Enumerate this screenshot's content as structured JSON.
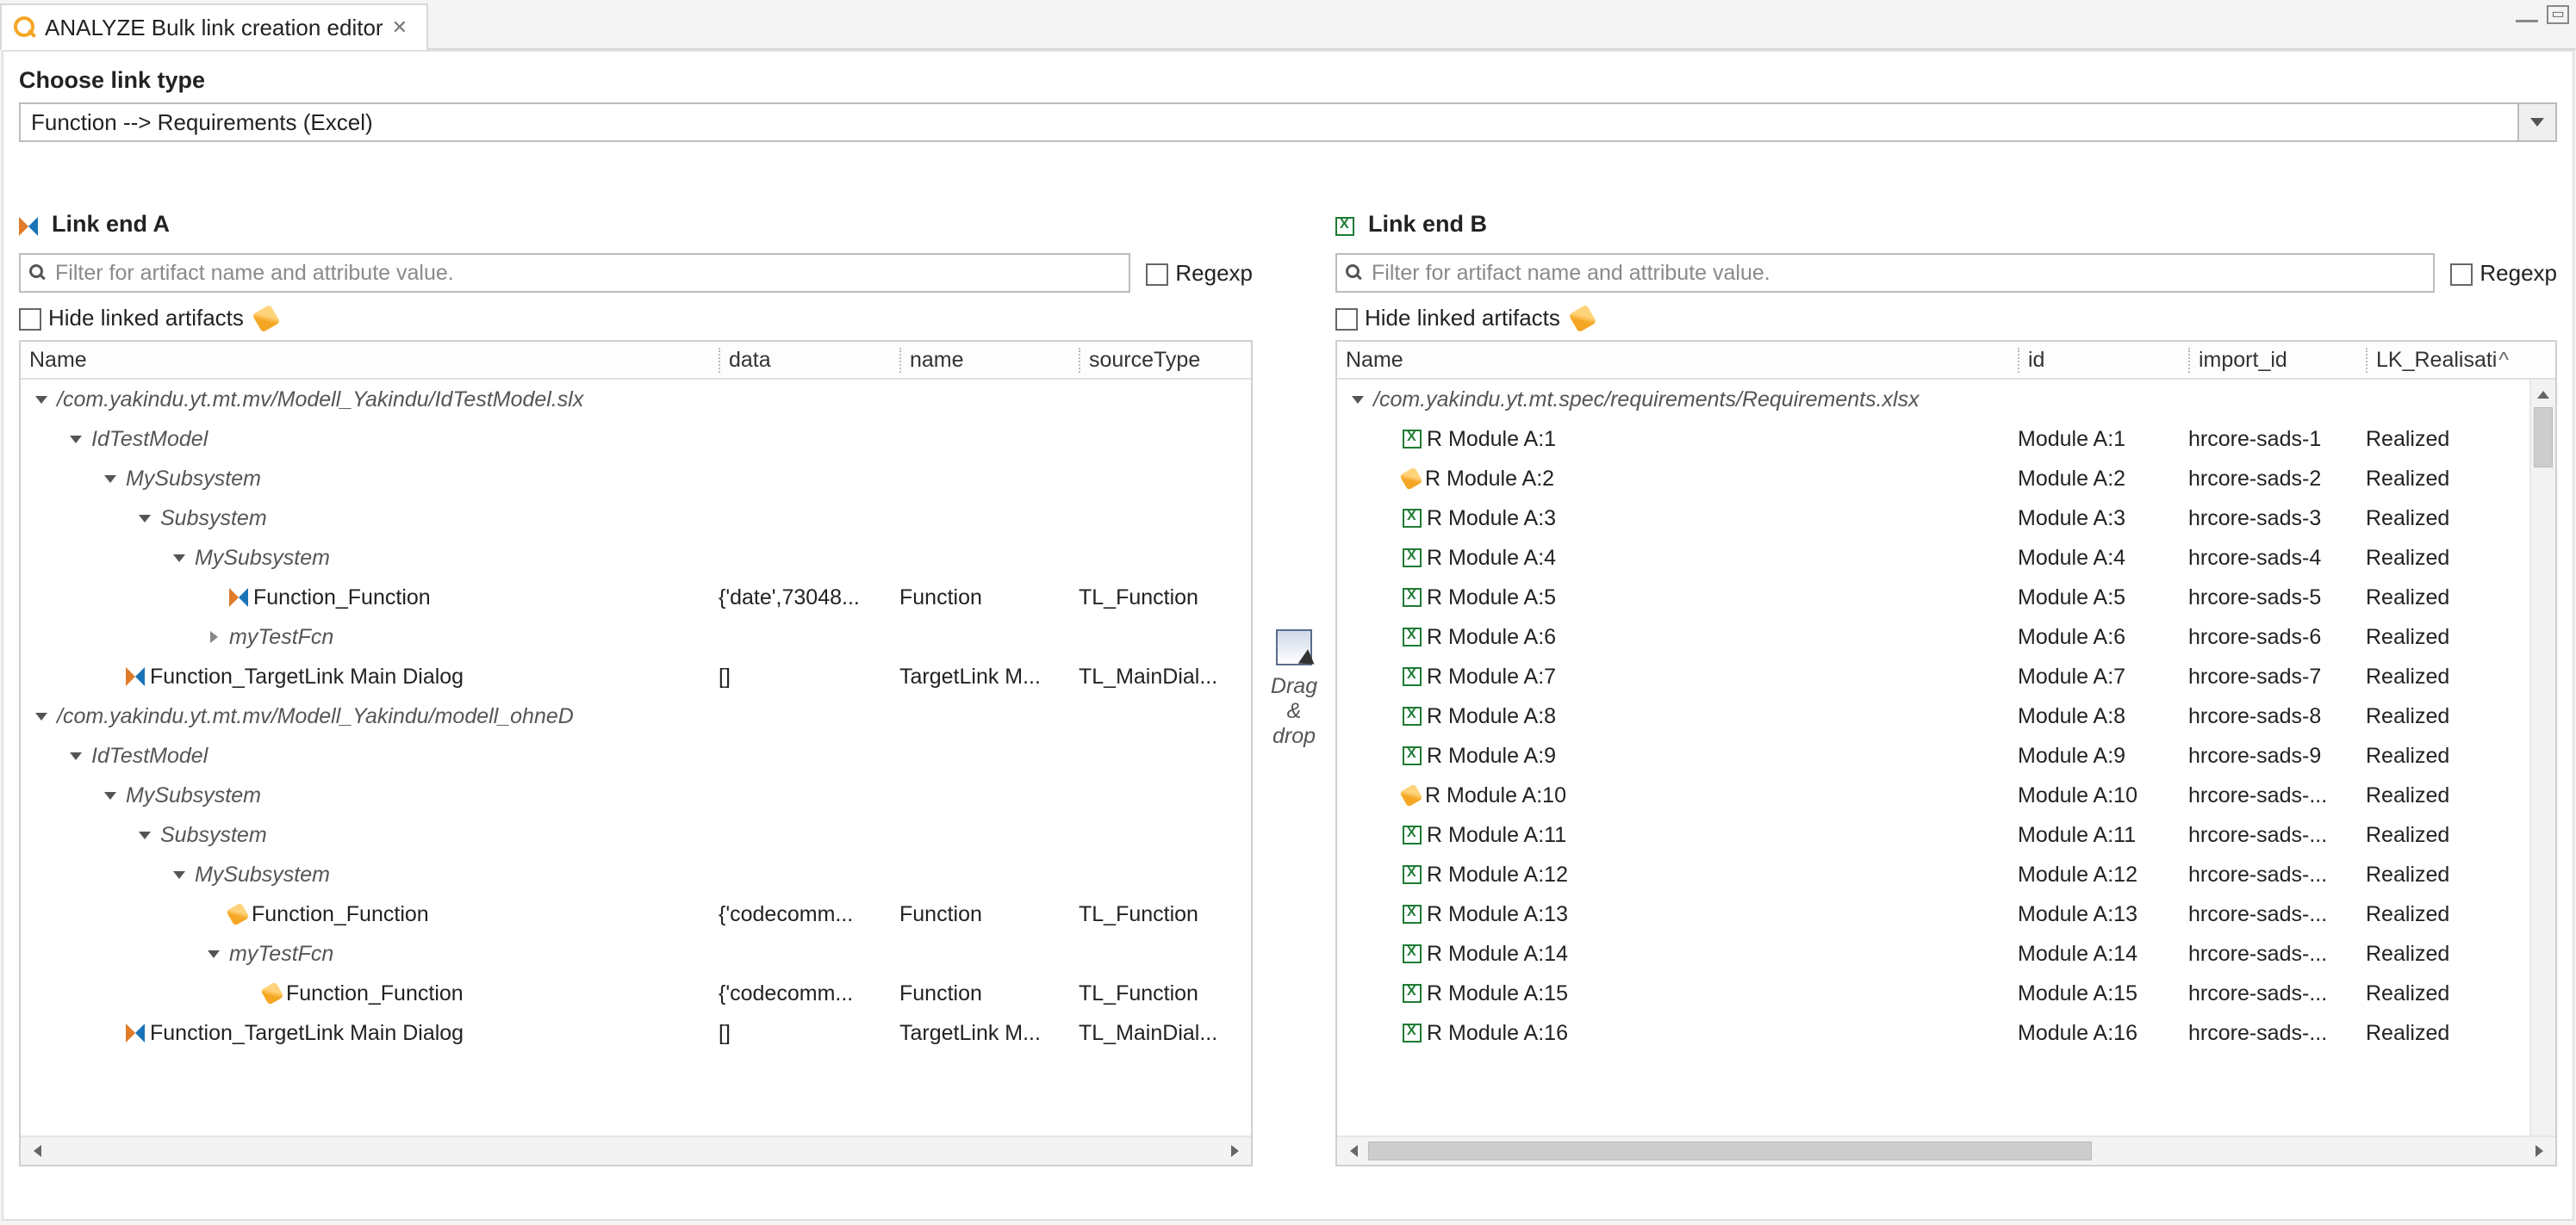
{
  "tab": {
    "title": "ANALYZE Bulk link creation editor"
  },
  "header": {
    "choose_label": "Choose link type",
    "link_type_value": "Function --> Requirements (Excel)"
  },
  "filters": {
    "placeholder": "Filter for artifact name and attribute value.",
    "regexp_label": "Regexp",
    "hide_linked_label": "Hide linked artifacts"
  },
  "divider": {
    "l1": "Drag",
    "l2": "&",
    "l3": "drop"
  },
  "paneA": {
    "title": "Link end A",
    "columns": {
      "name": "Name",
      "data": "data",
      "name2": "name",
      "src": "sourceType"
    },
    "rows": [
      {
        "d": 0,
        "tw": "down",
        "it": true,
        "t": "/com.yakindu.yt.mt.mv/Modell_Yakindu/IdTestModel.slx",
        "data": "",
        "n2": "",
        "src": ""
      },
      {
        "d": 1,
        "tw": "down",
        "it": true,
        "t": "IdTestModel",
        "data": "",
        "n2": "",
        "src": ""
      },
      {
        "d": 2,
        "tw": "down",
        "it": true,
        "t": "MySubsystem",
        "data": "",
        "n2": "",
        "src": ""
      },
      {
        "d": 3,
        "tw": "down",
        "it": true,
        "t": "Subsystem",
        "data": "",
        "n2": "",
        "src": ""
      },
      {
        "d": 4,
        "tw": "down",
        "it": true,
        "t": "MySubsystem",
        "data": "",
        "n2": "",
        "src": ""
      },
      {
        "d": 5,
        "tw": "",
        "icon": "ml",
        "t": "Function_Function",
        "data": "{'date',73048...",
        "n2": "Function",
        "src": "TL_Function"
      },
      {
        "d": 5,
        "tw": "right",
        "it": true,
        "t": "myTestFcn",
        "data": "",
        "n2": "",
        "src": ""
      },
      {
        "d": 2,
        "tw": "",
        "icon": "ml",
        "t": "Function_TargetLink Main Dialog",
        "data": "[]",
        "n2": "TargetLink M...",
        "src": "TL_MainDial..."
      },
      {
        "d": 0,
        "tw": "down",
        "it": true,
        "t": "/com.yakindu.yt.mt.mv/Modell_Yakindu/modell_ohneD",
        "data": "",
        "n2": "",
        "src": ""
      },
      {
        "d": 1,
        "tw": "down",
        "it": true,
        "t": "IdTestModel",
        "data": "",
        "n2": "",
        "src": ""
      },
      {
        "d": 2,
        "tw": "down",
        "it": true,
        "t": "MySubsystem",
        "data": "",
        "n2": "",
        "src": ""
      },
      {
        "d": 3,
        "tw": "down",
        "it": true,
        "t": "Subsystem",
        "data": "",
        "n2": "",
        "src": ""
      },
      {
        "d": 4,
        "tw": "down",
        "it": true,
        "t": "MySubsystem",
        "data": "",
        "n2": "",
        "src": ""
      },
      {
        "d": 5,
        "tw": "",
        "icon": "lk",
        "t": "Function_Function",
        "data": "{'codecomm...",
        "n2": "Function",
        "src": "TL_Function"
      },
      {
        "d": 5,
        "tw": "down",
        "it": true,
        "t": "myTestFcn",
        "data": "",
        "n2": "",
        "src": ""
      },
      {
        "d": 6,
        "tw": "",
        "icon": "lk",
        "t": "Function_Function",
        "data": "{'codecomm...",
        "n2": "Function",
        "src": "TL_Function"
      },
      {
        "d": 2,
        "tw": "",
        "icon": "ml",
        "t": "Function_TargetLink Main Dialog",
        "data": "[]",
        "n2": "TargetLink M...",
        "src": "TL_MainDial..."
      }
    ]
  },
  "paneB": {
    "title": "Link end B",
    "columns": {
      "name": "Name",
      "id": "id",
      "imp": "import_id",
      "lk": "LK_Realisati"
    },
    "root": "/com.yakindu.yt.mt.spec/requirements/Requirements.xlsx",
    "rows": [
      {
        "icon": "xl",
        "t": "R Module A:1",
        "id": "Module A:1",
        "imp": "hrcore-sads-1",
        "lk": "Realized"
      },
      {
        "icon": "lk",
        "t": "R Module A:2",
        "id": "Module A:2",
        "imp": "hrcore-sads-2",
        "lk": "Realized"
      },
      {
        "icon": "xl",
        "t": "R Module A:3",
        "id": "Module A:3",
        "imp": "hrcore-sads-3",
        "lk": "Realized"
      },
      {
        "icon": "xl",
        "t": "R Module A:4",
        "id": "Module A:4",
        "imp": "hrcore-sads-4",
        "lk": "Realized"
      },
      {
        "icon": "xl",
        "t": "R Module A:5",
        "id": "Module A:5",
        "imp": "hrcore-sads-5",
        "lk": "Realized"
      },
      {
        "icon": "xl",
        "t": "R Module A:6",
        "id": "Module A:6",
        "imp": "hrcore-sads-6",
        "lk": "Realized"
      },
      {
        "icon": "xl",
        "t": "R Module A:7",
        "id": "Module A:7",
        "imp": "hrcore-sads-7",
        "lk": "Realized"
      },
      {
        "icon": "xl",
        "t": "R Module A:8",
        "id": "Module A:8",
        "imp": "hrcore-sads-8",
        "lk": "Realized"
      },
      {
        "icon": "xl",
        "t": "R Module A:9",
        "id": "Module A:9",
        "imp": "hrcore-sads-9",
        "lk": "Realized"
      },
      {
        "icon": "lk",
        "t": "R Module A:10",
        "id": "Module A:10",
        "imp": "hrcore-sads-...",
        "lk": "Realized"
      },
      {
        "icon": "xl",
        "t": "R Module A:11",
        "id": "Module A:11",
        "imp": "hrcore-sads-...",
        "lk": "Realized"
      },
      {
        "icon": "xl",
        "t": "R Module A:12",
        "id": "Module A:12",
        "imp": "hrcore-sads-...",
        "lk": "Realized"
      },
      {
        "icon": "xl",
        "t": "R Module A:13",
        "id": "Module A:13",
        "imp": "hrcore-sads-...",
        "lk": "Realized"
      },
      {
        "icon": "xl",
        "t": "R Module A:14",
        "id": "Module A:14",
        "imp": "hrcore-sads-...",
        "lk": "Realized"
      },
      {
        "icon": "xl",
        "t": "R Module A:15",
        "id": "Module A:15",
        "imp": "hrcore-sads-...",
        "lk": "Realized"
      },
      {
        "icon": "xl",
        "t": "R Module A:16",
        "id": "Module A:16",
        "imp": "hrcore-sads-...",
        "lk": "Realized"
      }
    ]
  }
}
